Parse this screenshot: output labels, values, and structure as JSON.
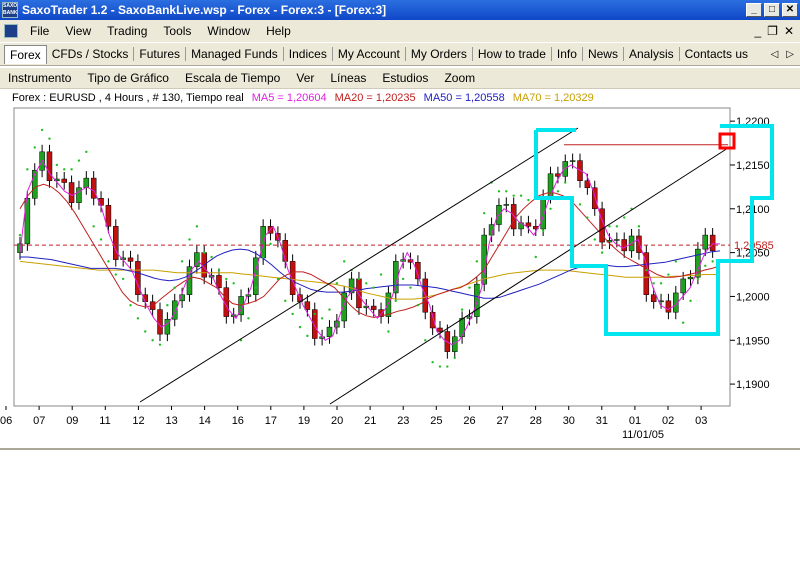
{
  "window": {
    "title": "SaxoTrader 1.2 - SaxoBankLive.wsp - Forex - Forex:3 - [Forex:3]",
    "app_icon_text": "SAXO BANK",
    "minimize_icon": "minimize-icon",
    "maximize_icon": "maximize-icon",
    "close_icon": "close-icon"
  },
  "menu": {
    "items": [
      "File",
      "View",
      "Trading",
      "Tools",
      "Window",
      "Help"
    ]
  },
  "nav_tabs": [
    "Forex",
    "CFDs / Stocks",
    "Futures",
    "Managed Funds",
    "Indices",
    "My Account",
    "My Orders",
    "How to trade",
    "Info",
    "News",
    "Analysis",
    "Contacts us"
  ],
  "chart_menu": [
    "Instrumento",
    "Tipo de Gráfico",
    "Escala de Tiempo",
    "Ver",
    "Líneas",
    "Estudios",
    "Zoom"
  ],
  "info": {
    "instrument": "Forex : EURUSD , 4 Hours , # 130, Tiempo real",
    "ma5": "MA5 = 1,20604",
    "ma20": "MA20 = 1,20235",
    "ma50": "MA50 = 1,20558",
    "ma70": "MA70 = 1,20329",
    "colors": {
      "ma5": "#e020e0",
      "ma20": "#c02020",
      "ma50": "#2020c0",
      "ma70": "#c8a000"
    }
  },
  "chart_data": {
    "type": "candlestick",
    "instrument": "EURUSD",
    "timeframe": "4 Hours",
    "y_ticks": [
      "1,2200",
      "1,2150",
      "1,2100",
      "1,2050",
      "1,2000",
      "1,1950",
      "1,1900"
    ],
    "ylim": [
      1.1875,
      1.2215
    ],
    "current_price_label": "1,20585",
    "current_price": 1.20585,
    "x_ticks": [
      "06",
      "07",
      "09",
      "11",
      "12",
      "13",
      "14",
      "16",
      "17",
      "19",
      "20",
      "21",
      "23",
      "25",
      "26",
      "27",
      "28",
      "30",
      "31",
      "01",
      "02",
      "03"
    ],
    "x_sub_label": "11/01/05",
    "colors": {
      "up": "#20a020",
      "down": "#c01010",
      "annotation": "#00e5ee",
      "marker": "#ff0000"
    },
    "ma5": [
      1.205,
      1.212,
      1.214,
      1.2155,
      1.214,
      1.213,
      1.212,
      1.2115,
      1.212,
      1.2125,
      1.212,
      1.21,
      1.207,
      1.205,
      1.204,
      1.203,
      1.201,
      1.199,
      1.1975,
      1.1965,
      1.197,
      1.1985,
      1.201,
      1.203,
      1.204,
      1.203,
      1.202,
      1.2,
      1.1985,
      1.1975,
      1.199,
      1.201,
      1.204,
      1.207,
      1.208,
      1.206,
      1.203,
      1.201,
      1.199,
      1.1975,
      1.196,
      1.195,
      1.1955,
      1.198,
      1.2,
      1.201,
      1.1995,
      1.1985,
      1.1975,
      1.1985,
      1.2,
      1.203,
      1.205,
      1.2035,
      1.201,
      1.199,
      1.196,
      1.195,
      1.1945,
      1.195,
      1.1965,
      1.1985,
      1.201,
      1.206,
      1.209,
      1.21,
      1.2095,
      1.2085,
      1.208,
      1.207,
      1.2085,
      1.211,
      1.213,
      1.2145,
      1.215,
      1.2145,
      1.214,
      1.212,
      1.209,
      1.207,
      1.206,
      1.2055,
      1.206,
      1.2065,
      1.204,
      1.201,
      1.199,
      1.1985,
      1.199,
      1.2,
      1.201,
      1.203,
      1.205,
      1.206,
      1.206
    ],
    "ma20": [
      1.21,
      1.2115,
      1.2125,
      1.2128,
      1.2125,
      1.2118,
      1.2108,
      1.2095,
      1.208,
      1.2065,
      1.205,
      1.2035,
      1.202,
      1.2005,
      1.1995,
      1.199,
      1.1988,
      1.199,
      1.1998,
      1.2005,
      1.2012,
      1.2018,
      1.2022,
      1.202,
      1.2015,
      1.201,
      1.2,
      1.1992,
      1.199,
      1.1992,
      1.1995,
      1.2,
      1.201,
      1.202,
      1.2025,
      1.2028,
      1.2028,
      1.2025,
      1.202,
      1.2015,
      1.201,
      1.2,
      1.199,
      1.1982,
      1.1978,
      1.1976,
      1.1978,
      1.198,
      1.1983,
      1.1985,
      1.1988,
      1.1992,
      1.1998,
      1.2002,
      1.2005,
      1.2008,
      1.201,
      1.2015,
      1.2022,
      1.203,
      1.2045,
      1.206,
      1.2075,
      1.209,
      1.21,
      1.2108,
      1.2115,
      1.2118,
      1.2118,
      1.2115,
      1.211,
      1.21,
      1.209,
      1.208,
      1.207,
      1.206,
      1.2052,
      1.2045,
      1.204,
      1.2035,
      1.203,
      1.2025,
      1.2022,
      1.2022,
      1.2023,
      1.2025,
      1.2027,
      1.203,
      1.2032,
      1.2035
    ],
    "ma50": [
      1.2045,
      1.2045,
      1.2044,
      1.2043,
      1.2042,
      1.204,
      1.2038,
      1.2036,
      1.2034,
      1.2032,
      1.2032,
      1.2032,
      1.2032,
      1.2031,
      1.2029,
      1.2027,
      1.2024,
      1.2021,
      1.2019,
      1.2018,
      1.2019,
      1.2022,
      1.2027,
      1.2033,
      1.204,
      1.2046,
      1.205,
      1.2053,
      1.2054,
      1.2053,
      1.2049,
      1.2043,
      1.2036,
      1.2028,
      1.2021,
      1.2016,
      1.2012,
      1.2008,
      1.2006,
      1.2005,
      1.2005,
      1.2005,
      1.2006,
      1.2007,
      1.2009,
      1.201,
      1.2011,
      1.2012,
      1.2013,
      1.2013,
      1.2013,
      1.2012,
      1.2011,
      1.201,
      1.2008,
      1.2006,
      1.2004,
      1.2002,
      1.2,
      1.1998,
      1.1998,
      1.1999,
      1.2002,
      1.2005,
      1.2008,
      1.2011,
      1.2014,
      1.2018,
      1.2022,
      1.2026,
      1.203,
      1.2033,
      1.2035,
      1.2036,
      1.2036,
      1.2035,
      1.2034,
      1.2034,
      1.2035,
      1.2036,
      1.2037,
      1.2038,
      1.2039,
      1.2041,
      1.2043,
      1.2045,
      1.2047,
      1.2049,
      1.2051,
      1.2052
    ],
    "ma70": [
      1.204,
      1.2039,
      1.2038,
      1.2037,
      1.2036,
      1.2035,
      1.2034,
      1.2033,
      1.2032,
      1.2031,
      1.203,
      1.203,
      1.203,
      1.203,
      1.203,
      1.203,
      1.203,
      1.203,
      1.2029,
      1.2028,
      1.2027,
      1.2027,
      1.2027,
      1.2027,
      1.2027,
      1.2027,
      1.2027,
      1.2027,
      1.2026,
      1.2025,
      1.2024,
      1.2023,
      1.2022,
      1.2021,
      1.202,
      1.2019,
      1.2018,
      1.2017,
      1.2016,
      1.2015,
      1.2014,
      1.2012,
      1.201,
      1.2007,
      1.2004,
      1.2002,
      1.2,
      1.1998,
      1.1997,
      1.1997,
      1.1997,
      1.1998,
      1.2,
      1.2002,
      1.2005,
      1.2008,
      1.2011,
      1.2014,
      1.2017,
      1.202,
      1.2022,
      1.2024,
      1.2026,
      1.2027,
      1.2028,
      1.2029,
      1.203,
      1.203,
      1.203,
      1.203,
      1.2029,
      1.2028,
      1.2027,
      1.2026,
      1.2025,
      1.2024,
      1.2023,
      1.2022,
      1.2022,
      1.2022,
      1.2022,
      1.2022,
      1.2022,
      1.2023,
      1.2023,
      1.2024,
      1.2024,
      1.2025,
      1.2025,
      1.2025
    ]
  }
}
